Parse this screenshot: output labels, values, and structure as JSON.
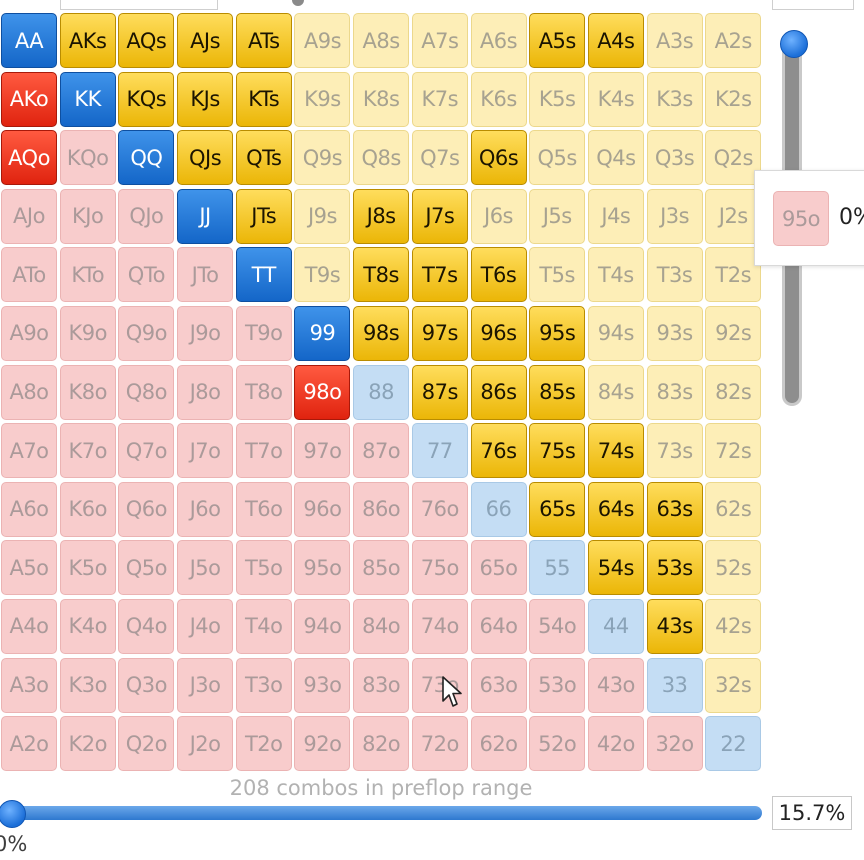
{
  "grid": {
    "rows": [
      [
        "AA",
        "AKs",
        "AQs",
        "AJs",
        "ATs",
        "A9s",
        "A8s",
        "A7s",
        "A6s",
        "A5s",
        "A4s",
        "A3s",
        "A2s"
      ],
      [
        "AKo",
        "KK",
        "KQs",
        "KJs",
        "KTs",
        "K9s",
        "K8s",
        "K7s",
        "K6s",
        "K5s",
        "K4s",
        "K3s",
        "K2s"
      ],
      [
        "AQo",
        "KQo",
        "QQ",
        "QJs",
        "QTs",
        "Q9s",
        "Q8s",
        "Q7s",
        "Q6s",
        "Q5s",
        "Q4s",
        "Q3s",
        "Q2s"
      ],
      [
        "AJo",
        "KJo",
        "QJo",
        "JJ",
        "JTs",
        "J9s",
        "J8s",
        "J7s",
        "J6s",
        "J5s",
        "J4s",
        "J3s",
        "J2s"
      ],
      [
        "ATo",
        "KTo",
        "QTo",
        "JTo",
        "TT",
        "T9s",
        "T8s",
        "T7s",
        "T6s",
        "T5s",
        "T4s",
        "T3s",
        "T2s"
      ],
      [
        "A9o",
        "K9o",
        "Q9o",
        "J9o",
        "T9o",
        "99",
        "98s",
        "97s",
        "96s",
        "95s",
        "94s",
        "93s",
        "92s"
      ],
      [
        "A8o",
        "K8o",
        "Q8o",
        "J8o",
        "T8o",
        "98o",
        "88",
        "87s",
        "86s",
        "85s",
        "84s",
        "83s",
        "82s"
      ],
      [
        "A7o",
        "K7o",
        "Q7o",
        "J7o",
        "T7o",
        "97o",
        "87o",
        "77",
        "76s",
        "75s",
        "74s",
        "73s",
        "72s"
      ],
      [
        "A6o",
        "K6o",
        "Q6o",
        "J6o",
        "T6o",
        "96o",
        "86o",
        "76o",
        "66",
        "65s",
        "64s",
        "63s",
        "62s"
      ],
      [
        "A5o",
        "K5o",
        "Q5o",
        "J5o",
        "T5o",
        "95o",
        "85o",
        "75o",
        "65o",
        "55",
        "54s",
        "53s",
        "52s"
      ],
      [
        "A4o",
        "K4o",
        "Q4o",
        "J4o",
        "T4o",
        "94o",
        "84o",
        "74o",
        "64o",
        "54o",
        "44",
        "43s",
        "42s"
      ],
      [
        "A3o",
        "K3o",
        "Q3o",
        "J3o",
        "T3o",
        "93o",
        "83o",
        "73o",
        "63o",
        "53o",
        "43o",
        "33",
        "32s"
      ],
      [
        "A2o",
        "K2o",
        "Q2o",
        "J2o",
        "T2o",
        "92o",
        "82o",
        "72o",
        "62o",
        "52o",
        "42o",
        "32o",
        "22"
      ]
    ],
    "selected": [
      "AA",
      "KK",
      "QQ",
      "JJ",
      "TT",
      "99",
      "AKs",
      "AQs",
      "AJs",
      "ATs",
      "A5s",
      "A4s",
      "KQs",
      "KJs",
      "KTs",
      "QJs",
      "QTs",
      "Q6s",
      "JTs",
      "J8s",
      "J7s",
      "T8s",
      "T7s",
      "T6s",
      "98s",
      "97s",
      "96s",
      "95s",
      "87s",
      "86s",
      "85s",
      "76s",
      "75s",
      "74s",
      "65s",
      "64s",
      "63s",
      "54s",
      "53s",
      "43s",
      "AKo",
      "AQo",
      "98o"
    ],
    "raise_hands": [
      "AKo",
      "AQo",
      "98o"
    ]
  },
  "colors": {
    "pair_selected": "#1466c8",
    "offsuit_selected": "#e0230f",
    "suited_selected": "#ebb607",
    "pair_unselected": "#c4ddf4",
    "suited_unselected": "#fdeeb7",
    "offsuit_unselected": "#f8cccc"
  },
  "tooltip": {
    "hand": "95o",
    "percent": "0%"
  },
  "combos_label": "208 combos in preflop range",
  "range_slider": {
    "min_label": "0%",
    "value_text": "15.7%",
    "value": 15.7
  },
  "icons": {
    "cursor": "mouse-pointer-icon"
  }
}
